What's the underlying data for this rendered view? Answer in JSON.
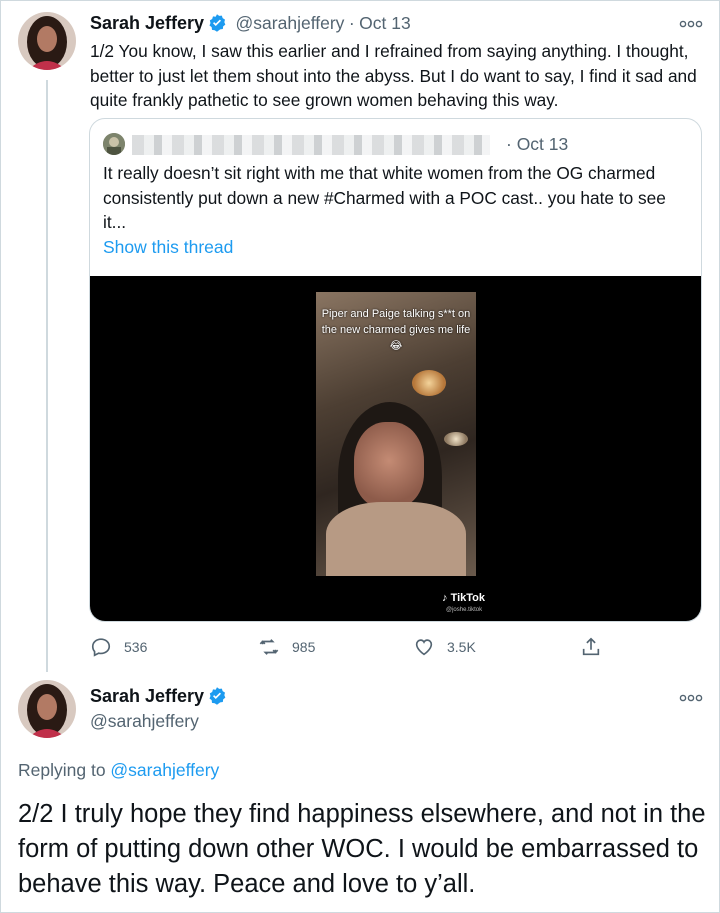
{
  "tweet1": {
    "author_name": "Sarah Jeffery",
    "handle": "@sarahjeffery",
    "separator": "·",
    "date": "Oct 13",
    "text": "1/2 You know, I saw this earlier and I refrained from saying anything. I thought, better to just let them shout into the abyss. But I do want to say, I find it sad and quite frankly pathetic to see grown women behaving this way."
  },
  "quoted": {
    "date": "· Oct 13",
    "text": "It really doesn’t sit right with me that white women from the OG charmed consistently put down a new #Charmed with a POC cast.. you hate to see it...",
    "show_thread": "Show this thread",
    "video": {
      "caption": "Piper and Paige talking s**t on the new charmed gives me life 😂",
      "watermark": "TikTok",
      "watermark_user": "@joshe.tiktok"
    }
  },
  "actions": {
    "reply_icon": "reply-icon",
    "reply_count": "536",
    "retweet_icon": "retweet-icon",
    "retweet_count": "985",
    "like_icon": "heart-icon",
    "like_count": "3.5K",
    "share_icon": "share-icon"
  },
  "tweet2": {
    "author_name": "Sarah Jeffery",
    "handle": "@sarahjeffery",
    "replying_prefix": "Replying to ",
    "replying_to": "@sarahjeffery",
    "text": "2/2 I truly hope they find happiness elsewhere, and not in the form of putting down other WOC. I would be embarrassed to behave this way. Peace and love to y’all."
  },
  "colors": {
    "accent": "#1d9bf0",
    "muted": "#536471",
    "border": "#cfd9de"
  }
}
